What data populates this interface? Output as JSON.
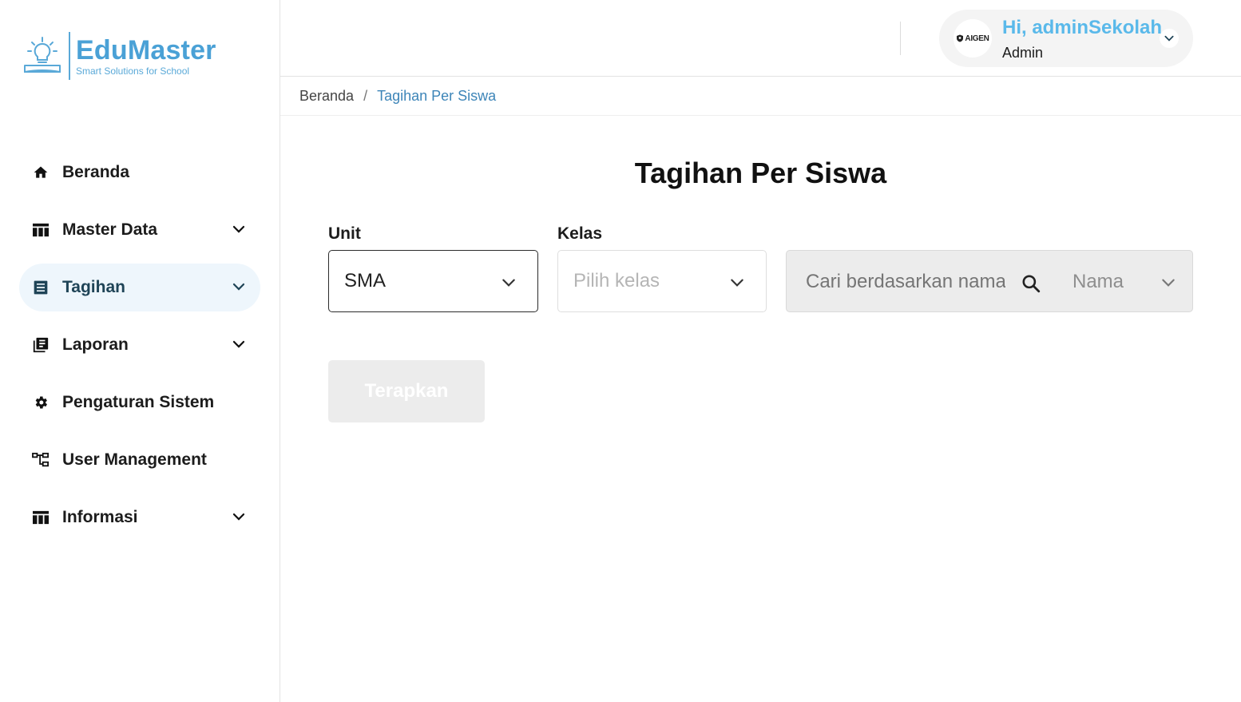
{
  "brand": {
    "name": "EduMaster",
    "tagline": "Smart Solutions for School",
    "color": "#4aa1d6"
  },
  "sidebar": {
    "items": [
      {
        "label": "Beranda",
        "icon": "home-icon",
        "expandable": false,
        "active": false
      },
      {
        "label": "Master Data",
        "icon": "table-icon",
        "expandable": true,
        "active": false
      },
      {
        "label": "Tagihan",
        "icon": "list-icon",
        "expandable": true,
        "active": true
      },
      {
        "label": "Laporan",
        "icon": "library-icon",
        "expandable": true,
        "active": false
      },
      {
        "label": "Pengaturan Sistem",
        "icon": "gear-icon",
        "expandable": false,
        "active": false
      },
      {
        "label": "User Management",
        "icon": "hierarchy-icon",
        "expandable": false,
        "active": false
      },
      {
        "label": "Informasi",
        "icon": "table-icon",
        "expandable": true,
        "active": false
      }
    ]
  },
  "header": {
    "avatar_text": "AIGEN",
    "greeting": "Hi, adminSekolah",
    "role": "Admin"
  },
  "breadcrumb": {
    "home": "Beranda",
    "separator": "/",
    "current": "Tagihan Per Siswa"
  },
  "page": {
    "title": "Tagihan Per Siswa"
  },
  "filters": {
    "unit_label": "Unit",
    "unit_value": "SMA",
    "kelas_label": "Kelas",
    "kelas_placeholder": "Pilih kelas",
    "search_placeholder": "Cari berdasarkan nama",
    "search_mode": "Nama",
    "apply_label": "Terapkan"
  },
  "colors": {
    "accent": "#5ab9ea",
    "active_nav_bg": "#eef6fc",
    "breadcrumb_current": "#3d85b8",
    "disabled_bg": "#ececec"
  }
}
